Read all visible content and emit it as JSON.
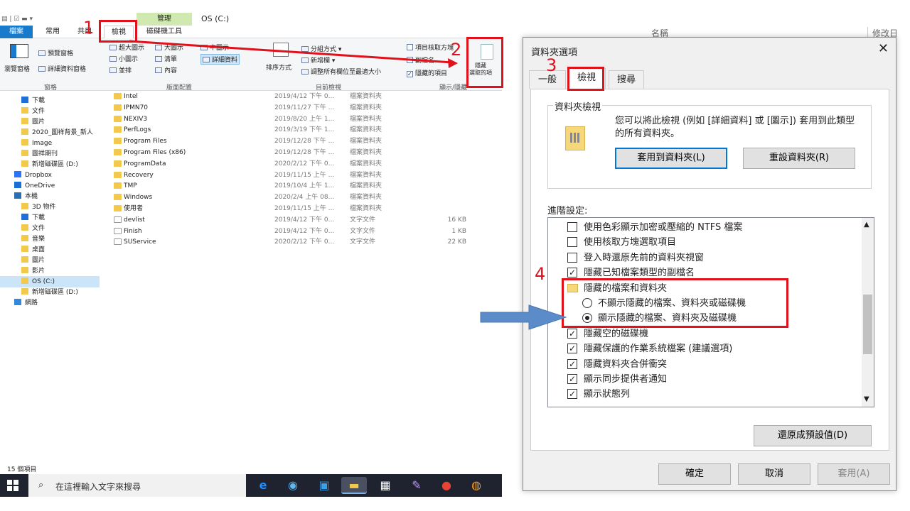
{
  "explorer": {
    "window_title": "OS (C:)",
    "context_tab": "管理",
    "tabs": [
      "檔案",
      "常用",
      "共用",
      "檢視",
      "磁碟機工具"
    ],
    "ribbon": {
      "pane_items": [
        "瀏覽窗格",
        "預覽窗格",
        "詳細資料窗格"
      ],
      "layout_items": [
        "超大圖示",
        "大圖示",
        "中圖示",
        "小圖示",
        "清單",
        "詳細資料",
        "並排",
        "內容"
      ],
      "current_view_items": [
        "排序方式",
        "分組方式",
        "新增欄",
        "調整所有欄位至最適大小"
      ],
      "show_hide_items": [
        "項目核取方塊",
        "副檔名",
        "隱藏的項目"
      ],
      "hide_selected": "隱藏\n選取的項",
      "groups": [
        "窗格",
        "版面配置",
        "目前檢視",
        "顯示/隱藏"
      ]
    },
    "nav": [
      "下載",
      "文件",
      "圖片",
      "2020_圖祥背景_新人",
      "Image",
      "圖祥期刊",
      "新增磁碟區 (D:)",
      "Dropbox",
      "OneDrive",
      "本機",
      "3D 物件",
      "下載",
      "文件",
      "音樂",
      "桌面",
      "圖片",
      "影片",
      "OS (C:)",
      "新增磁碟區 (D:)",
      "網路"
    ],
    "files": [
      {
        "name": "Intel",
        "date": "2019/4/12 下午 0...",
        "type": "檔案資料夾",
        "size": "",
        "kind": "folder"
      },
      {
        "name": "IPMN70",
        "date": "2019/11/27 下午 ...",
        "type": "檔案資料夾",
        "size": "",
        "kind": "folder"
      },
      {
        "name": "NEXIV3",
        "date": "2019/8/20 上午 1...",
        "type": "檔案資料夾",
        "size": "",
        "kind": "folder"
      },
      {
        "name": "PerfLogs",
        "date": "2019/3/19 下午 1...",
        "type": "檔案資料夾",
        "size": "",
        "kind": "folder"
      },
      {
        "name": "Program Files",
        "date": "2019/12/28 下午 ...",
        "type": "檔案資料夾",
        "size": "",
        "kind": "folder"
      },
      {
        "name": "Program Files (x86)",
        "date": "2019/12/28 下午 ...",
        "type": "檔案資料夾",
        "size": "",
        "kind": "folder"
      },
      {
        "name": "ProgramData",
        "date": "2020/2/12 下午 0...",
        "type": "檔案資料夾",
        "size": "",
        "kind": "folder"
      },
      {
        "name": "Recovery",
        "date": "2019/11/15 上午 ...",
        "type": "檔案資料夾",
        "size": "",
        "kind": "folder"
      },
      {
        "name": "TMP",
        "date": "2019/10/4 上午 1...",
        "type": "檔案資料夾",
        "size": "",
        "kind": "folder"
      },
      {
        "name": "Windows",
        "date": "2020/2/4 上午 08...",
        "type": "檔案資料夾",
        "size": "",
        "kind": "folder"
      },
      {
        "name": "使用者",
        "date": "2019/11/15 上午 ...",
        "type": "檔案資料夾",
        "size": "",
        "kind": "folder"
      },
      {
        "name": "devlist",
        "date": "2019/4/12 下午 0...",
        "type": "文字文件",
        "size": "16 KB",
        "kind": "doc"
      },
      {
        "name": "Finish",
        "date": "2019/4/12 下午 0...",
        "type": "文字文件",
        "size": "1 KB",
        "kind": "doc"
      },
      {
        "name": "SUService",
        "date": "2020/2/12 下午 0...",
        "type": "文字文件",
        "size": "22 KB",
        "kind": "doc"
      }
    ],
    "status": "15 個項目"
  },
  "taskbar": {
    "search_placeholder": "在這裡輸入文字來搜尋"
  },
  "background_header": {
    "col_name": "名稱",
    "col_modified": "修改日"
  },
  "dialog": {
    "title": "資料夾選項",
    "tabs": [
      "一般",
      "檢視",
      "搜尋"
    ],
    "folder_views_label": "資料夾檢視",
    "folder_views_desc": "您可以將此檢視 (例如 [詳細資料] 或 [圖示]) 套用到此類型的所有資料夾。",
    "apply_btn": "套用到資料夾(L)",
    "reset_btn": "重設資料夾(R)",
    "advanced_label": "進階設定:",
    "advanced": [
      {
        "type": "checkbox",
        "label": "使用色彩顯示加密或壓縮的 NTFS 檔案",
        "checked": false
      },
      {
        "type": "checkbox",
        "label": "使用核取方塊選取項目",
        "checked": false
      },
      {
        "type": "checkbox",
        "label": "登入時還原先前的資料夾視窗",
        "checked": false
      },
      {
        "type": "checkbox",
        "label": "隱藏已知檔案類型的副檔名",
        "checked": true
      },
      {
        "type": "folder",
        "label": "隱藏的檔案和資料夾"
      },
      {
        "type": "radio",
        "label": "不顯示隱藏的檔案、資料夾或磁碟機",
        "checked": false
      },
      {
        "type": "radio",
        "label": "顯示隱藏的檔案、資料夾及磁碟機",
        "checked": true
      },
      {
        "type": "checkbox",
        "label": "隱藏空的磁碟機",
        "checked": true
      },
      {
        "type": "checkbox",
        "label": "隱藏保護的作業系統檔案 (建議選項)",
        "checked": true
      },
      {
        "type": "checkbox",
        "label": "隱藏資料夾合併衝突",
        "checked": true
      },
      {
        "type": "checkbox",
        "label": "顯示同步提供者通知",
        "checked": true
      },
      {
        "type": "checkbox",
        "label": "顯示狀態列",
        "checked": true
      }
    ],
    "restore_btn": "還原成預設值(D)",
    "ok_btn": "確定",
    "cancel_btn": "取消",
    "apply_disabled_btn": "套用(A)"
  },
  "annotations": {
    "n1": "1",
    "n2": "2",
    "n3": "3",
    "n4": "4"
  },
  "colors": {
    "annotation_red": "#e0111b",
    "arrow_blue": "#5b8bc9",
    "selection": "#cce4f7"
  }
}
